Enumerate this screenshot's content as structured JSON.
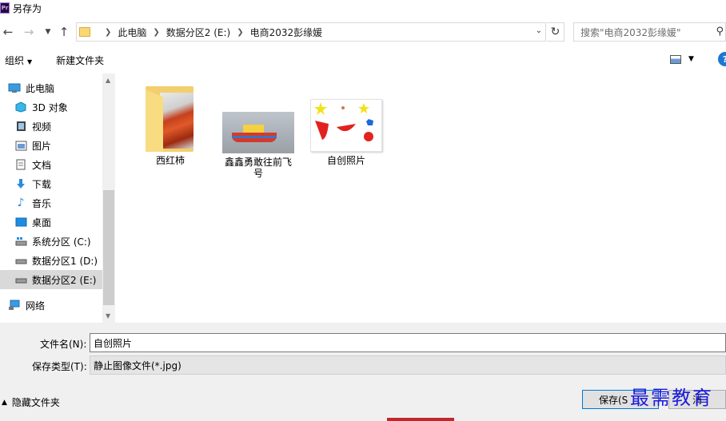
{
  "window": {
    "title": "另存为",
    "app_icon_text": "Pr"
  },
  "address": {
    "breadcrumbs": [
      "此电脑",
      "数据分区2 (E:)",
      "电商2032彭缘媛"
    ],
    "search_placeholder": "搜索\"电商2032彭缘媛\""
  },
  "toolbar": {
    "organize_label": "组织",
    "new_folder_label": "新建文件夹",
    "help_label": "?"
  },
  "sidebar": {
    "items": [
      {
        "label": "此电脑",
        "icon": "computer-icon"
      },
      {
        "label": "3D 对象",
        "icon": "cube-icon"
      },
      {
        "label": "视频",
        "icon": "video-icon"
      },
      {
        "label": "图片",
        "icon": "picture-icon"
      },
      {
        "label": "文档",
        "icon": "document-icon"
      },
      {
        "label": "下载",
        "icon": "download-icon"
      },
      {
        "label": "音乐",
        "icon": "music-icon"
      },
      {
        "label": "桌面",
        "icon": "desktop-icon"
      },
      {
        "label": "系统分区 (C:)",
        "icon": "drive-icon"
      },
      {
        "label": "数据分区1 (D:)",
        "icon": "drive-icon"
      },
      {
        "label": "数据分区2 (E:)",
        "icon": "drive-icon"
      },
      {
        "label": "网络",
        "icon": "network-icon"
      }
    ],
    "selected_index": 10
  },
  "files": [
    {
      "label": "西红柿",
      "kind": "folder"
    },
    {
      "label": "鑫鑫勇敢往前飞号",
      "kind": "image"
    },
    {
      "label": "自创照片",
      "kind": "image"
    }
  ],
  "form": {
    "filename_label": "文件名(N):",
    "filename_value": "自创照片",
    "filetype_label": "保存类型(T):",
    "filetype_value": "静止图像文件(*.jpg)",
    "hide_folders_label": "隐藏文件夹",
    "save_label": "保存(S",
    "cancel_label": "消"
  },
  "watermark": {
    "text": "最需教育"
  },
  "colors": {
    "accent": "#0078d7",
    "selection": "#d9d9d9",
    "watermark": "#1b1bd9"
  }
}
